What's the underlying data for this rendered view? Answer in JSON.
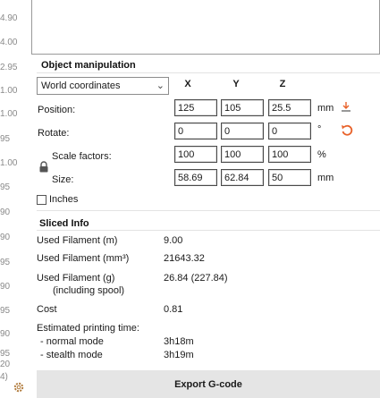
{
  "gutter_numbers": [
    "4.90",
    "4.00",
    "2.95",
    "1.00",
    "1.00",
    "95",
    "1.00",
    "95",
    "90",
    "90",
    "95",
    "90",
    "95",
    "90",
    "95",
    "20",
    "4)"
  ],
  "object_manipulation": {
    "title": "Object manipulation",
    "coordinates_select": "World coordinates",
    "axes": [
      "X",
      "Y",
      "Z"
    ],
    "position_label": "Position:",
    "rotate_label": "Rotate:",
    "scale_label": "Scale factors:",
    "size_label": "Size:",
    "position": [
      "125",
      "105",
      "25.5"
    ],
    "rotate": [
      "0",
      "0",
      "0"
    ],
    "scale": [
      "100",
      "100",
      "100"
    ],
    "size": [
      "58.69",
      "62.84",
      "50"
    ],
    "units": {
      "position": "mm",
      "rotate": "°",
      "scale": "%",
      "size": "mm"
    },
    "inches_label": "Inches"
  },
  "sliced_info": {
    "title": "Sliced Info",
    "used_filament_m_label": "Used Filament (m)",
    "used_filament_m": "9.00",
    "used_filament_mm3_label": "Used Filament (mm³)",
    "used_filament_mm3": "21643.32",
    "used_filament_g_label": "Used Filament (g)",
    "used_filament_g_sub": "(including spool)",
    "used_filament_g": "26.84 (227.84)",
    "cost_label": "Cost",
    "cost": "0.81",
    "print_time_label": "Estimated printing time:",
    "normal_mode_label": "- normal mode",
    "normal_mode": "3h18m",
    "stealth_mode_label": "- stealth mode",
    "stealth_mode": "3h19m"
  },
  "export_button": "Export G-code",
  "colors": {
    "reset_icon": "#e8622a",
    "drop_icon": "#e8622a"
  }
}
